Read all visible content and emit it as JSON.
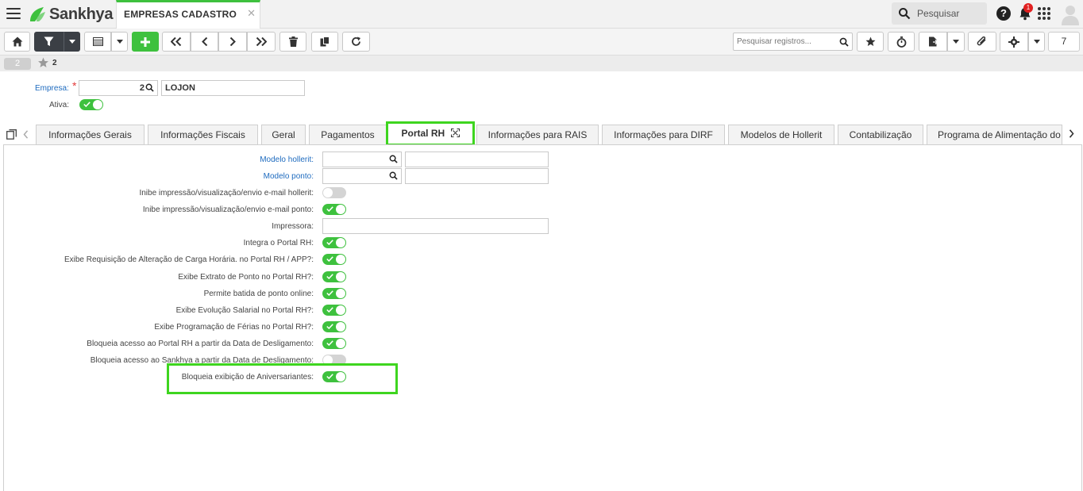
{
  "app": {
    "brand": "Sankhya",
    "window_tab": "EMPRESAS CADASTRO",
    "search_placeholder": "Pesquisar",
    "notification_count": "1",
    "help_label": "?"
  },
  "toolbar": {
    "search_placeholder": "Pesquisar registros...",
    "page_size": "7"
  },
  "record": {
    "index": "2",
    "favorite_number": "2"
  },
  "empresa": {
    "label": "Empresa:",
    "code": "2",
    "name": "LOJON",
    "ativa_label": "Ativa:",
    "ativa": true
  },
  "tabs": [
    {
      "label": "Informações Gerais"
    },
    {
      "label": "Informações Fiscais"
    },
    {
      "label": "Geral"
    },
    {
      "label": "Pagamentos"
    },
    {
      "label": "Portal RH",
      "active": true
    },
    {
      "label": "Informações para RAIS"
    },
    {
      "label": "Informações para DIRF"
    },
    {
      "label": "Modelos de Hollerit"
    },
    {
      "label": "Contabilização"
    },
    {
      "label": "Programa de Alimentação do"
    }
  ],
  "portal_rh": {
    "modelo_hollerit_label": "Modelo hollerit:",
    "modelo_ponto_label": "Modelo ponto:",
    "impressora_label": "Impressora:",
    "toggles": [
      {
        "label": "Inibe impressão/visualização/envio e-mail hollerit:",
        "on": false
      },
      {
        "label": "Inibe impressão/visualização/envio e-mail ponto:",
        "on": true
      },
      {
        "label": "Integra o Portal RH:",
        "on": true
      },
      {
        "label": "Exibe Requisição de Alteração de Carga Horária. no Portal RH / APP?:",
        "on": true
      },
      {
        "label": "Exibe Extrato de Ponto no Portal RH?:",
        "on": true
      },
      {
        "label": "Permite batida de ponto online:",
        "on": true
      },
      {
        "label": "Exibe Evolução Salarial no Portal RH?:",
        "on": true
      },
      {
        "label": "Exibe Programação de Férias no Portal RH?:",
        "on": true
      },
      {
        "label": "Bloqueia acesso ao Portal RH a partir da Data de Desligamento:",
        "on": true
      },
      {
        "label": "Bloqueia acesso ao Sankhya a partir da Data de Desligamento:",
        "on": false
      },
      {
        "label": "Bloqueia exibição de Aniversariantes:",
        "on": true
      }
    ]
  },
  "colors": {
    "accent_green": "#3ec13e",
    "highlight_green": "#3ed51f",
    "link_blue": "#1e6bbf",
    "required_red": "#e23b3b",
    "badge_red": "#e12020"
  },
  "icons": [
    "menu-icon",
    "search-icon",
    "help-icon",
    "bell-icon",
    "apps-grid-icon",
    "user-avatar-icon",
    "home-icon",
    "filter-icon",
    "grid-view-icon",
    "plus-icon",
    "first-icon",
    "previous-icon",
    "next-icon",
    "last-icon",
    "trash-icon",
    "copy-icon",
    "refresh-icon",
    "star-icon",
    "timer-icon",
    "document-icon",
    "attachment-icon",
    "gear-icon",
    "chevron-left-icon",
    "chevron-right-icon",
    "expand-icon",
    "check-icon"
  ]
}
